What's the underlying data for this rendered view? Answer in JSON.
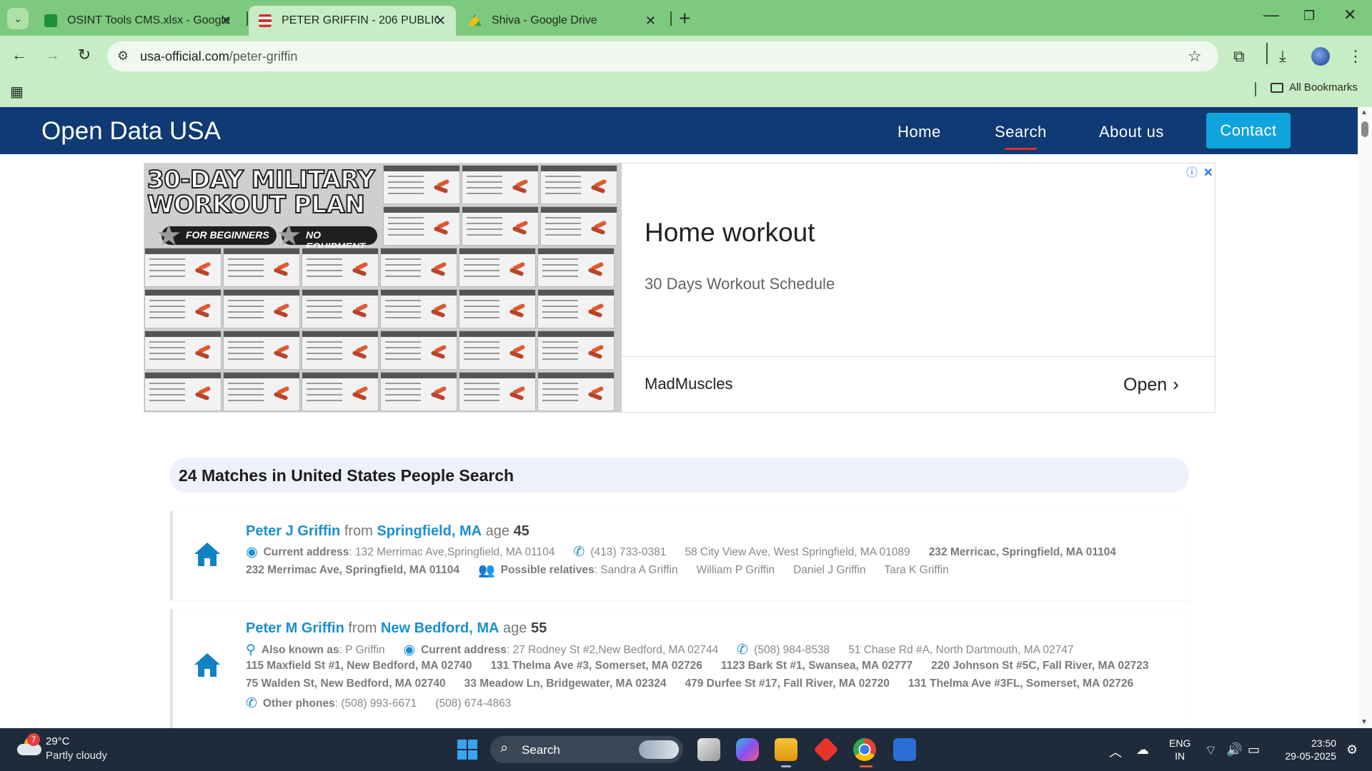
{
  "browser": {
    "tabs": [
      {
        "title": "OSINT Tools CMS.xlsx - Google",
        "icon": "sheets-icon"
      },
      {
        "title": "PETER GRIFFIN - 206 PUBLIC",
        "icon": "flag-icon"
      },
      {
        "title": "Shiva - Google Drive",
        "icon": "drive-icon"
      }
    ],
    "url_host": "usa-official.com",
    "url_path": "/peter-griffin",
    "bookmarks_label": "All Bookmarks"
  },
  "site": {
    "brand": "Open Data USA",
    "nav": [
      {
        "label": "Home"
      },
      {
        "label": "Search",
        "active": true
      },
      {
        "label": "About us"
      },
      {
        "label": "Contact"
      }
    ]
  },
  "ad": {
    "image_title_line1": "30-DAY MILITARY",
    "image_title_line2": "WORKOUT PLAN",
    "tag1": "FOR BEGINNERS",
    "tag2": "NO EQUIPMENT",
    "headline": "Home workout",
    "description": "30 Days Workout Schedule",
    "advertiser": "MadMuscles",
    "cta": "Open"
  },
  "results": {
    "heading": "24 Matches in United States People Search",
    "records": [
      {
        "name": "Peter J Griffin",
        "from_word": "from",
        "city": "Springfield, MA",
        "age_word": "age",
        "age": "45",
        "current_address_label": "Current address",
        "current_address": "132 Merrimac Ave,Springfield, MA 01104",
        "phone": "(413) 733-0381",
        "other_addresses": [
          "58 City View Ave, West Springfield, MA 01089"
        ],
        "bold_addresses": [
          "232 Merricac, Springfield, MA 01104",
          "232 Merrimac Ave, Springfield, MA 01104"
        ],
        "relatives_label": "Possible relatives",
        "relatives": [
          "Sandra A Griffin",
          "William P Griffin",
          "Daniel J Griffin",
          "Tara K Griffin"
        ]
      },
      {
        "name": "Peter M Griffin",
        "from_word": "from",
        "city": "New Bedford, MA",
        "age_word": "age",
        "age": "55",
        "aka_label": "Also known as",
        "aka": "P Griffin",
        "current_address_label": "Current address",
        "current_address": "27 Rodney St #2,New Bedford, MA 02744",
        "phone": "(508) 984-8538",
        "other_addresses": [
          "51 Chase Rd #A, North Dartmouth, MA 02747"
        ],
        "bold_addresses": [
          "115 Maxfield St #1, New Bedford, MA 02740",
          "131 Thelma Ave #3, Somerset, MA 02726",
          "1123 Bark St #1, Swansea, MA 02777",
          "220 Johnson St #5C, Fall River, MA 02723",
          "75 Walden St, New Bedford, MA 02740",
          "33 Meadow Ln, Bridgewater, MA 02324",
          "479 Durfee St #17, Fall River, MA 02720",
          "131 Thelma Ave #3FL, Somerset, MA 02726"
        ],
        "other_phones_label": "Other phones",
        "other_phones": [
          "(508) 993-6671",
          "(508) 674-4863"
        ]
      }
    ]
  },
  "taskbar": {
    "weather_badge": "7",
    "temperature": "29°C",
    "weather": "Partly cloudy",
    "search_label": "Search",
    "lang_line1": "ENG",
    "lang_line2": "IN",
    "time": "23:50",
    "date": "29-05-2025"
  }
}
